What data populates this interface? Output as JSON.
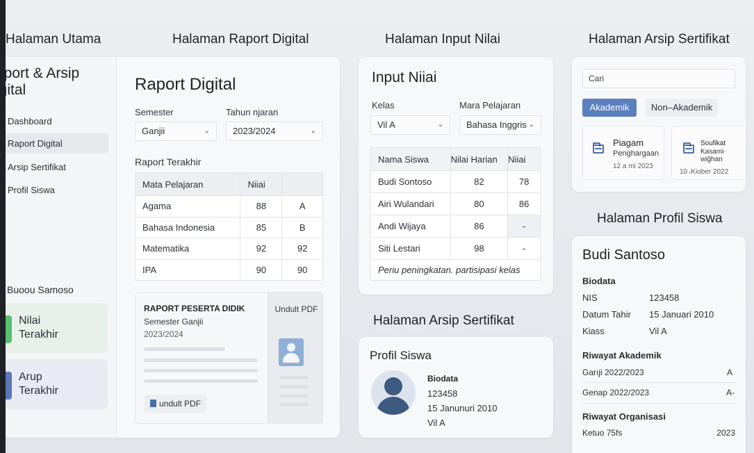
{
  "titles": {
    "home": "Halaman Utama",
    "raport": "Halaman Raport Digital",
    "input": "Halaman Input Nilai",
    "arsip_top": "Halaman Arsip Sertifikat",
    "profil": "Halaman Profil Siswa",
    "arsip_bottom": "Halaman Arsip Sertifikat"
  },
  "sidebar": {
    "brand_line1": "aport & Arsip",
    "brand_line2": "igital",
    "items": [
      {
        "label": "Dashboard"
      },
      {
        "label": "Raport Digital"
      },
      {
        "label": "Arsip Sertifikat"
      },
      {
        "label": "Profil Siswa"
      }
    ],
    "user_name": "Buoou Samoso",
    "stats": [
      {
        "line1": "Nilai",
        "line2": "Terakhir",
        "color": "#5cbf6e"
      },
      {
        "line1": "Arup",
        "line2": "Terakhir",
        "color": "#5b78b5"
      }
    ]
  },
  "raport": {
    "heading": "Raport Digital",
    "semester_label": "Semester",
    "semester_value": "Ganjii",
    "year_label": "Tahun njaran",
    "year_value": "2023/2024",
    "table_title": "Raport Terakhir",
    "columns": [
      "Mata Pelajaran",
      "Niiai",
      ""
    ],
    "rows": [
      [
        "Agama",
        "88",
        "A"
      ],
      [
        "Bahasa Indonesia",
        "85",
        "B"
      ],
      [
        "Matematika",
        "92",
        "92"
      ],
      [
        "IPA",
        "90",
        "90"
      ]
    ],
    "doc_title": "RAPORT PESERTA DIDIK",
    "doc_semester": "Semester Ganjii",
    "doc_year": "2023/2024",
    "download_header": "Undult PDF",
    "download_button": "undult PDF"
  },
  "input": {
    "heading": "Input Niiai",
    "class_label": "Kelas",
    "class_value": "Vil A",
    "subject_label": "Mara Pelajaran",
    "subject_value": "Bahasa Inggris",
    "columns": [
      "Nama Siswa",
      "Nilai Harian",
      "Niiai"
    ],
    "rows": [
      [
        "Budi Sontoso",
        "82",
        "78"
      ],
      [
        "Airi Wulandari",
        "80",
        "86"
      ],
      [
        "Andi Wijaya",
        "86",
        "-"
      ],
      [
        "Siti Lestari",
        "98",
        "-"
      ]
    ],
    "note": "Periu peningkatan. partisipasi kelas"
  },
  "arsip": {
    "search_placeholder": "Cari",
    "tab_active": "Akademik",
    "tab_other": "Non–Akademik",
    "certs": [
      {
        "title": "Piagam",
        "subtitle": "Penghargaan",
        "date": "12 a mi 2023"
      },
      {
        "title": "Soufikat",
        "subtitle": "Kasami·",
        "subtitle2": "wiĝhan",
        "date": "10 ᵣKiober 2022"
      }
    ]
  },
  "profil_card": {
    "heading": "Profil Siswa",
    "biodata_label": "Biodata",
    "nis": "123458",
    "dob": "15 Janunuri 2010",
    "class": "Vil A"
  },
  "profil": {
    "name": "Budi Santoso",
    "biodata_label": "Biodata",
    "fields": [
      {
        "key": "NIS",
        "value": "123458"
      },
      {
        "key": "Datum Tahir",
        "value": "15 Januari 2010"
      },
      {
        "key": "Kiass",
        "value": "Vil A"
      }
    ],
    "academic_label": "Riwayat Akademik",
    "academic": [
      {
        "period": "Garıji 2022/2023",
        "grade": "A"
      },
      {
        "period": "Genap 2022/2023",
        "grade": "A-"
      }
    ],
    "org_label": "Riwayat Organisasi",
    "org": {
      "role": "Ketuo 75fs",
      "year": "2023"
    }
  }
}
